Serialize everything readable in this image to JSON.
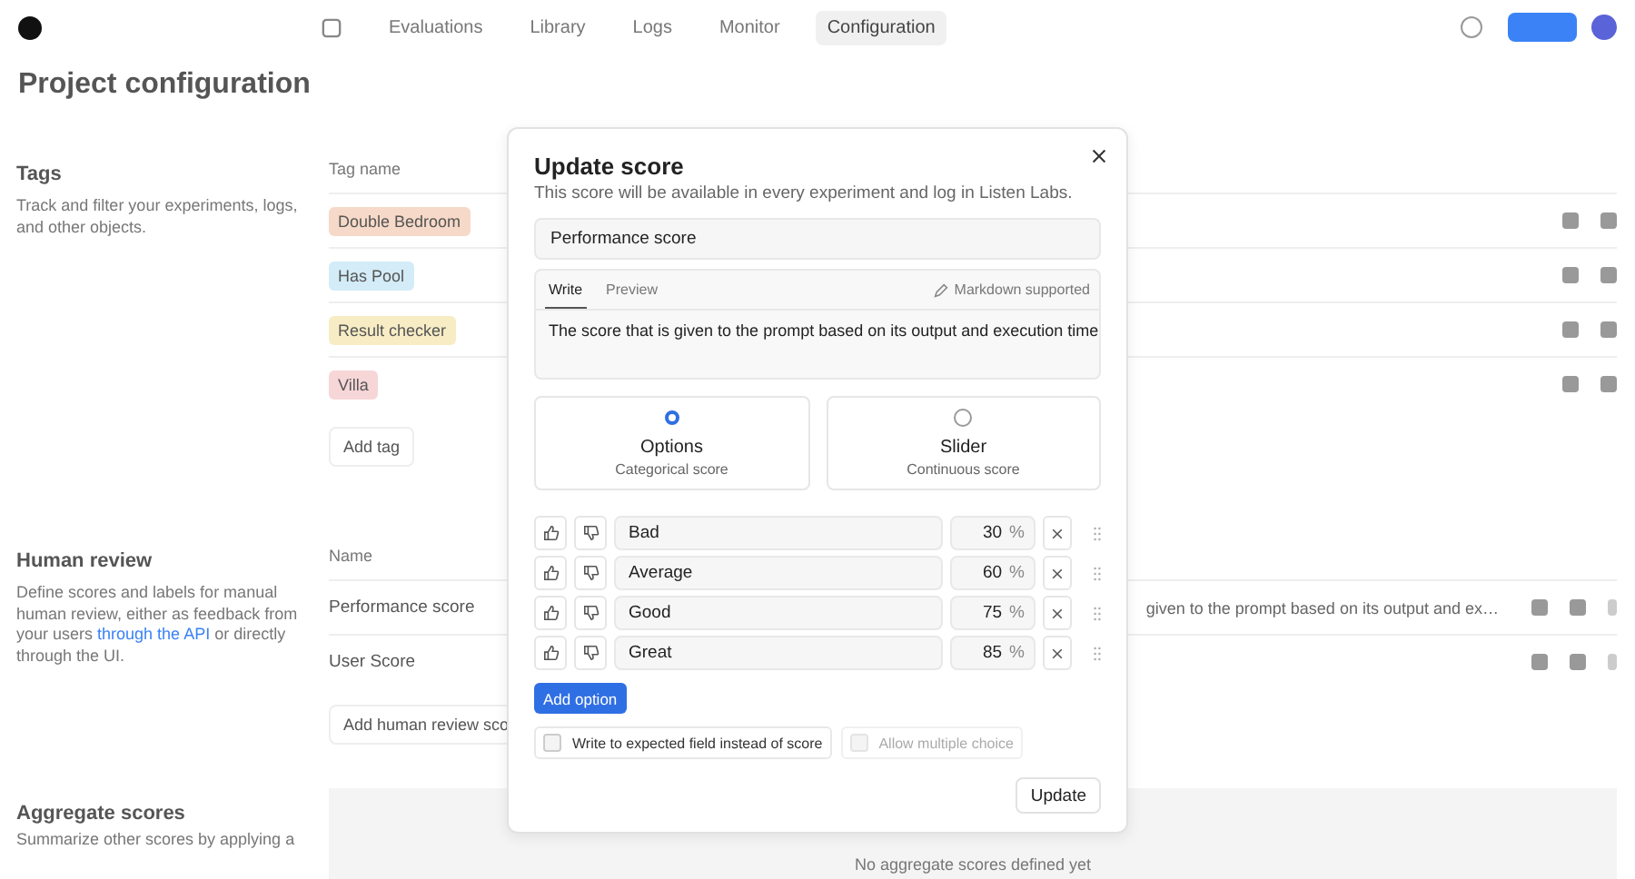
{
  "nav": {
    "tabs": [
      {
        "label": "Evaluations",
        "selected": false
      },
      {
        "label": "Library",
        "selected": false
      },
      {
        "label": "Logs",
        "selected": false
      },
      {
        "label": "Monitor",
        "selected": false
      },
      {
        "label": "Configuration",
        "selected": true
      }
    ]
  },
  "page_title": "Project configuration",
  "tags_section": {
    "title": "Tags",
    "description": "Track and filter your experiments, logs, and other objects.",
    "column": "Tag name",
    "tags": [
      {
        "label": "Double Bedroom",
        "color": "#f6d9c8"
      },
      {
        "label": "Has Pool",
        "color": "#d3ecf7"
      },
      {
        "label": "Result checker",
        "color": "#f7ecc4"
      },
      {
        "label": "Villa",
        "color": "#f7d6d8"
      }
    ],
    "add": "Add tag"
  },
  "human_review": {
    "title": "Human review",
    "description": "Define scores and labels for manual human review, either as feedback from your users **through the API** or directly through the UI.",
    "column": "Name",
    "rows": [
      {
        "name": "Performance score",
        "description": "given to the prompt based on its output and ex…"
      },
      {
        "name": "User Score"
      }
    ],
    "add": "Add human review sco"
  },
  "aggregate": {
    "title": "Aggregate scores",
    "description": "Summarize other scores by applying a",
    "empty": "No aggregate scores defined yet"
  },
  "dialog": {
    "title": "Update score",
    "subtitle": "This score will be available in every experiment and log in Listen Labs.",
    "name_value": "Performance score",
    "editor": {
      "tabs": [
        {
          "label": "Write",
          "selected": true
        },
        {
          "label": "Preview",
          "selected": false
        }
      ],
      "hint": "Markdown supported",
      "value": "The score that is given to the prompt based on its output and execution time"
    },
    "score_types": [
      {
        "label": "Options",
        "sublabel": "Categorical score",
        "selected": true
      },
      {
        "label": "Slider",
        "sublabel": "Continuous score",
        "selected": false
      }
    ],
    "options": [
      {
        "label": "Bad",
        "value": "30",
        "unit": "%"
      },
      {
        "label": "Average",
        "value": "60",
        "unit": "%"
      },
      {
        "label": "Good",
        "value": "75",
        "unit": "%"
      },
      {
        "label": "Great",
        "value": "85",
        "unit": "%"
      }
    ],
    "add_option": "Add option",
    "checkboxes": [
      {
        "label": "Write to expected field instead of score",
        "checked": false,
        "disabled": false
      },
      {
        "label": "Allow multiple choice",
        "checked": false,
        "disabled": true
      }
    ],
    "submit": "Update"
  }
}
